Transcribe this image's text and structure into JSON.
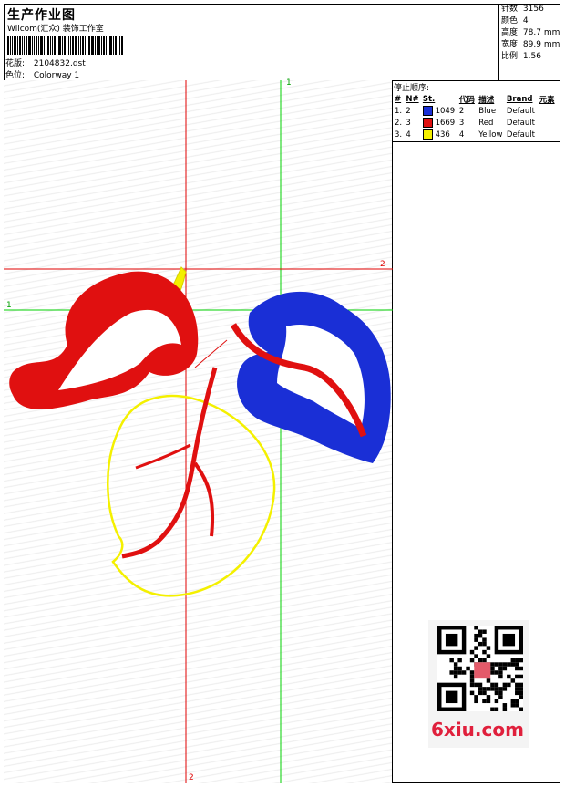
{
  "header": {
    "title": "生产作业图",
    "company": "Wilcom(汇众) 装饰工作室",
    "design_label": "花版:",
    "design_value": "2104832.dst",
    "colorway_label": "色位:",
    "colorway_value": "Colorway 1"
  },
  "stats": {
    "stitches_label": "针数:",
    "stitches_value": "3156",
    "colors_label": "颜色:",
    "colors_value": "4",
    "height_label": "高度:",
    "height_value": "78.7 mm",
    "width_label": "宽度:",
    "width_value": "89.9 mm",
    "scale_label": "比例:",
    "scale_value": "1.56"
  },
  "stop_sequence": {
    "title": "停止顺序:",
    "headers": [
      "#",
      "N#",
      "St.",
      "代码",
      "描述",
      "Brand",
      "元素"
    ],
    "rows": [
      {
        "index": "1.",
        "n": "2",
        "st": "1049",
        "code": "2",
        "desc": "Blue",
        "brand": "Default",
        "color": "#1a2fd6"
      },
      {
        "index": "2.",
        "n": "3",
        "st": "1669",
        "code": "3",
        "desc": "Red",
        "brand": "Default",
        "color": "#e01010"
      },
      {
        "index": "3.",
        "n": "4",
        "st": "436",
        "code": "4",
        "desc": "Yellow",
        "brand": "Default",
        "color": "#f4f000"
      }
    ]
  },
  "guides": {
    "v1": "1",
    "h1": "1",
    "h2": "2",
    "v2": "2"
  },
  "watermark": {
    "site": "6xiu.com"
  },
  "colors": {
    "red": "#e01010",
    "blue": "#1a2fd6",
    "yellow": "#f4f000",
    "guide_red": "#e00000",
    "guide_green": "#00d000"
  }
}
